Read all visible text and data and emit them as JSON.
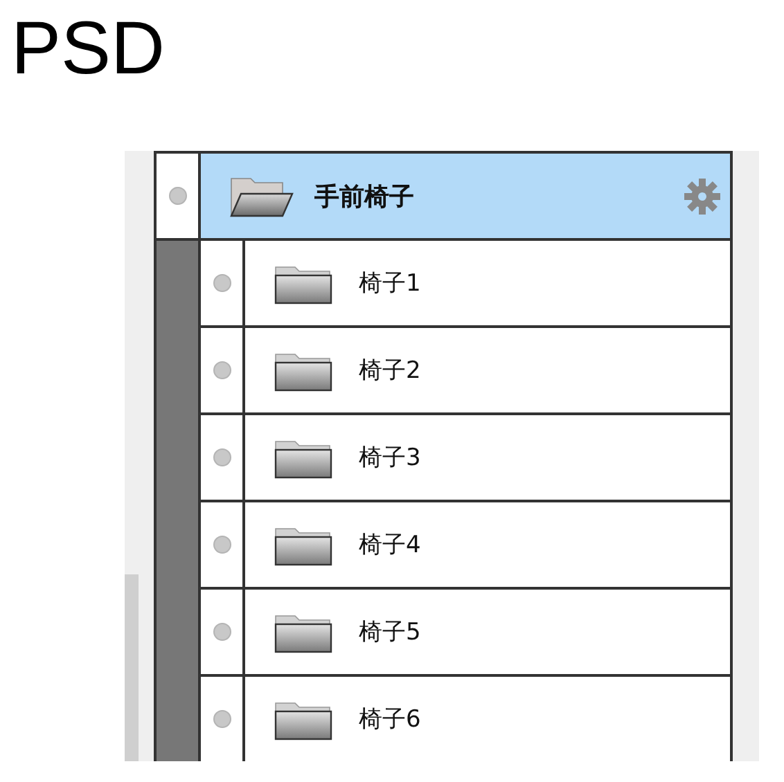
{
  "title": "PSD",
  "layers": {
    "group": {
      "name": "手前椅子",
      "selected": true,
      "expanded": true
    },
    "children": [
      {
        "name": "椅子1",
        "selected": false
      },
      {
        "name": "椅子2",
        "selected": false
      },
      {
        "name": "椅子3",
        "selected": false
      },
      {
        "name": "椅子4",
        "selected": false
      },
      {
        "name": "椅子5",
        "selected": false
      },
      {
        "name": "椅子6",
        "selected": false
      }
    ]
  }
}
